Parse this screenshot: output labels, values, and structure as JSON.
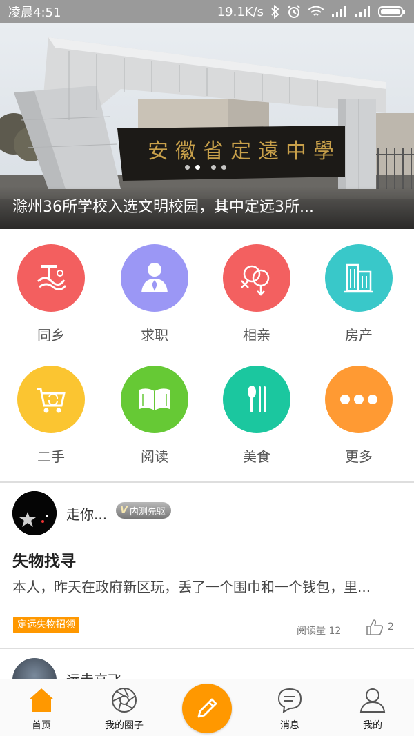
{
  "status_bar": {
    "time": "凌晨4:51",
    "net_speed": "19.1K/s"
  },
  "banner": {
    "title": "滁州36所学校入选文明校园，其中定远3所...",
    "gate_sign": "安徽省定遠中學",
    "page_count": 4,
    "active_page": 1
  },
  "categories": [
    {
      "label": "同乡",
      "color": "#f35f5f",
      "icon": "hometown-icon"
    },
    {
      "label": "求职",
      "color": "#9b97f5",
      "icon": "job-icon"
    },
    {
      "label": "相亲",
      "color": "#f36060",
      "icon": "dating-icon"
    },
    {
      "label": "房产",
      "color": "#39c8c9",
      "icon": "building-icon"
    },
    {
      "label": "二手",
      "color": "#fbc531",
      "icon": "cart-icon"
    },
    {
      "label": "阅读",
      "color": "#66c935",
      "icon": "book-icon"
    },
    {
      "label": "美食",
      "color": "#1bc79f",
      "icon": "food-icon"
    },
    {
      "label": "更多",
      "color": "#ff9a33",
      "icon": "more-icon"
    }
  ],
  "post": {
    "author": "走你...",
    "badge": "内测先驱",
    "title": "失物找寻",
    "excerpt": "本人，昨天在政府新区玩，丢了一个围巾和一个钱包，里...",
    "tag": "定远失物招领",
    "read_label": "阅读量",
    "read_count": "12",
    "likes": "2"
  },
  "next_post": {
    "author": "远走高飞"
  },
  "bottom_nav": {
    "home": "首页",
    "circle": "我的圈子",
    "messages": "消息",
    "mine": "我的"
  },
  "colors": {
    "accent": "#ff9800",
    "status_bar": "#9a9a9a"
  }
}
